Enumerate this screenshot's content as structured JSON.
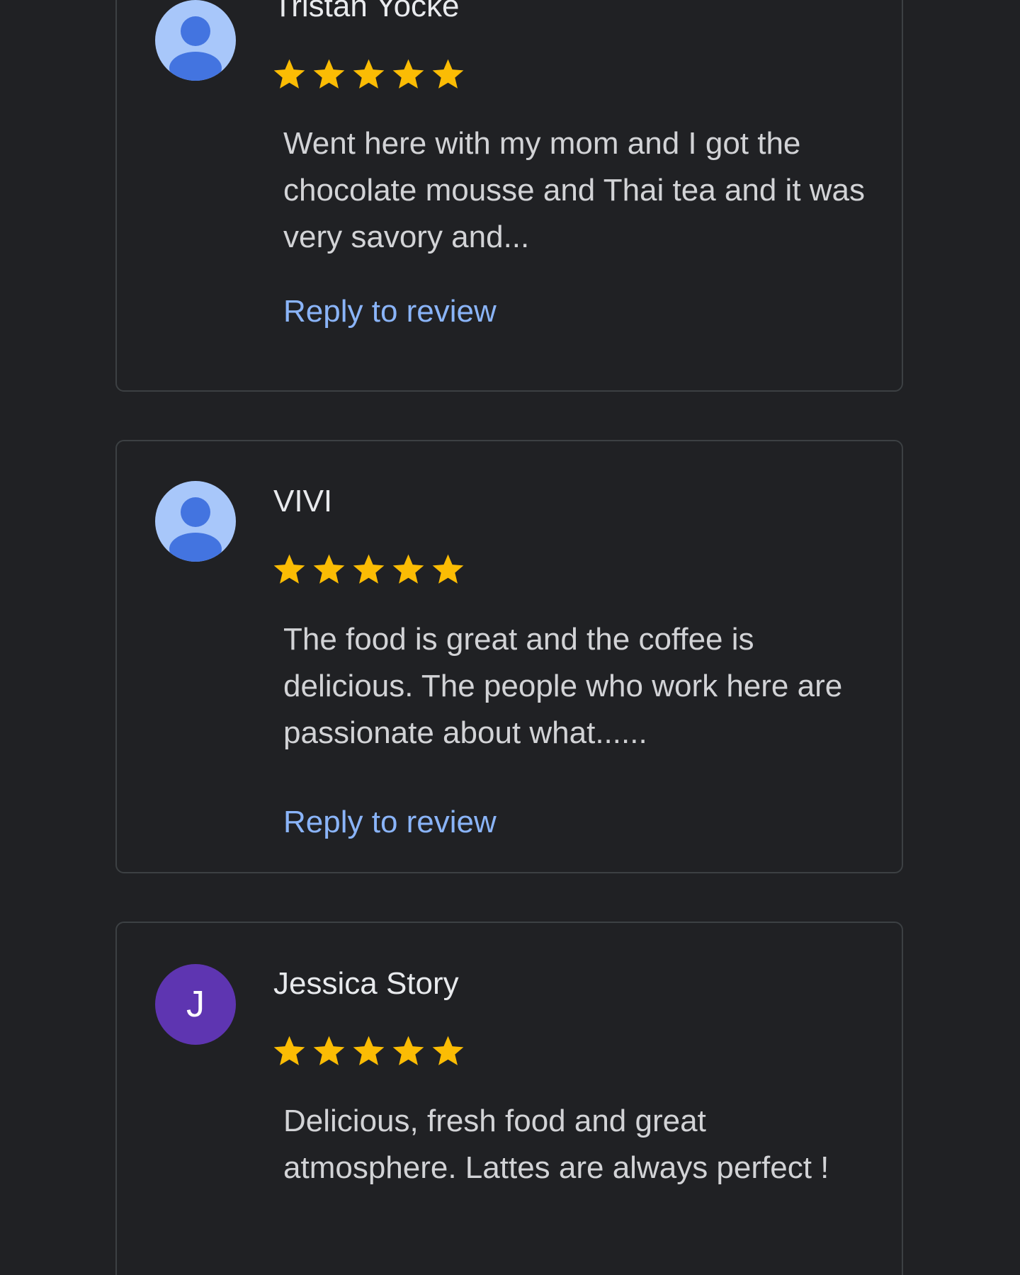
{
  "colors": {
    "background": "#202124",
    "card_border": "#3c4043",
    "name_text": "#e8eaed",
    "body_text": "#d2d3d6",
    "link": "#8ab4f8",
    "star": "#fbbc04",
    "default_avatar_bg": "#a8c7fa",
    "default_avatar_fg": "#4374e0",
    "letter_avatar_bg": "#5e35b1"
  },
  "reviews": [
    {
      "name": "Tristan Yocke",
      "avatar": "default-person-icon",
      "rating": 5,
      "text": "Went here with my mom and I got the chocolate mousse and Thai tea and it was very savory and...",
      "reply_label": "Reply to review"
    },
    {
      "name": "VIVI",
      "avatar": "default-person-icon",
      "rating": 5,
      "text": "The food is great and the coffee is delicious. The people who work here are passionate about what......",
      "reply_label": "Reply to review"
    },
    {
      "name": "Jessica Story",
      "avatar_letter": "J",
      "rating": 5,
      "text": "Delicious, fresh food and great atmosphere. Lattes are always perfect !"
    }
  ]
}
